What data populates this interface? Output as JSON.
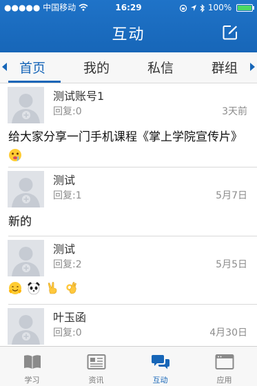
{
  "status_bar": {
    "carrier": "●●●●● 中国移动",
    "time": "16:29",
    "battery": "100%",
    "battery_level": 1.0
  },
  "header": {
    "title": "互动",
    "compose_icon": "compose-icon"
  },
  "tabs": [
    {
      "label": "首页",
      "active": true
    },
    {
      "label": "我的",
      "active": false
    },
    {
      "label": "私信",
      "active": false
    },
    {
      "label": "群组",
      "active": false
    }
  ],
  "posts": [
    {
      "author": "测试账号1",
      "replies": "回复:0",
      "date": "3天前",
      "content": "给大家分享一门手机课程《掌上学院宣传片》"
    },
    {
      "author": "测试",
      "replies": "回复:1",
      "date": "5月7日",
      "content": "新的"
    },
    {
      "author": "测试",
      "replies": "回复:2",
      "date": "5月5日",
      "content": ""
    },
    {
      "author": "叶玉函",
      "replies": "回复:0",
      "date": "4月30日",
      "content": ""
    }
  ],
  "tabbar": [
    {
      "label": "学习",
      "icon": "book-icon",
      "active": false
    },
    {
      "label": "资讯",
      "icon": "news-icon",
      "active": false
    },
    {
      "label": "互动",
      "icon": "chat-icon",
      "active": true
    },
    {
      "label": "应用",
      "icon": "app-window-icon",
      "active": false
    }
  ],
  "colors": {
    "brand_blue": "#1766b8",
    "avatar_bg": "#dfe2e7"
  }
}
